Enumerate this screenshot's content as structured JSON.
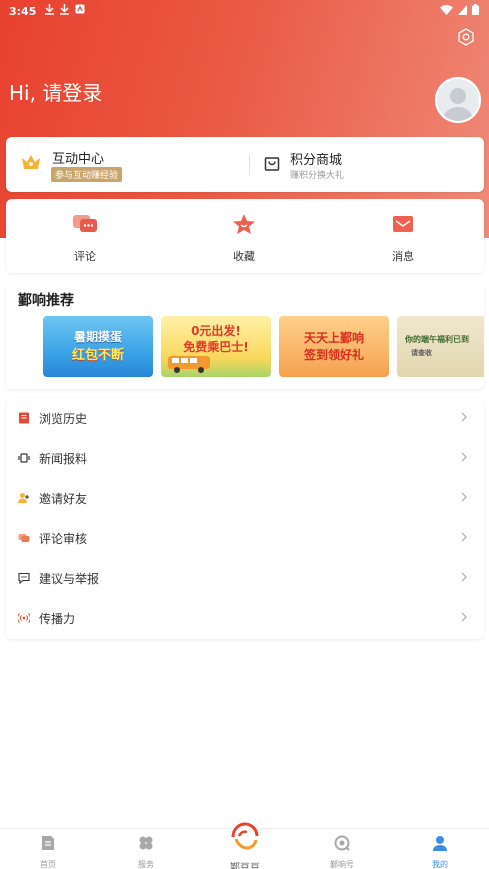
{
  "status_bar": {
    "time": "3:45"
  },
  "header": {
    "greeting": "Hi, 请登录"
  },
  "top_card": {
    "interaction_center": {
      "title": "互动中心",
      "badge": "参与互动赚经验"
    },
    "points_mall": {
      "title": "积分商城",
      "subtitle": "赚积分换大礼"
    }
  },
  "actions": [
    {
      "label": "评论",
      "icon": "comment-icon"
    },
    {
      "label": "收藏",
      "icon": "star-icon"
    },
    {
      "label": "消息",
      "icon": "mail-icon"
    }
  ],
  "recommend": {
    "title": "鄞响推荐",
    "banners": [
      {
        "line1": "暑期摸蛋",
        "line2": "红包不断"
      },
      {
        "line1": "0元出发!",
        "line2": "免费乘巴士!"
      },
      {
        "line1": "天天上鄞响",
        "line2": "签到领好礼"
      },
      {
        "line1": "你的端午福利已到",
        "line2": "请查收"
      }
    ]
  },
  "menu": [
    {
      "label": "浏览历史",
      "icon": "history-icon"
    },
    {
      "label": "新闻报料",
      "icon": "news-tip-icon"
    },
    {
      "label": "邀请好友",
      "icon": "invite-friends-icon"
    },
    {
      "label": "评论审核",
      "icon": "comment-review-icon"
    },
    {
      "label": "建议与举报",
      "icon": "feedback-icon"
    },
    {
      "label": "传播力",
      "icon": "broadcast-icon"
    }
  ],
  "tabbar": {
    "home": "首页",
    "services": "服务",
    "center": "鄞豆豆",
    "yinxiang_hao": "鄞响号",
    "mine": "我的"
  },
  "colors": {
    "brand_red": "#e8412f",
    "badge_gold": "#c9a56b",
    "active_blue": "#3a8ee6"
  }
}
